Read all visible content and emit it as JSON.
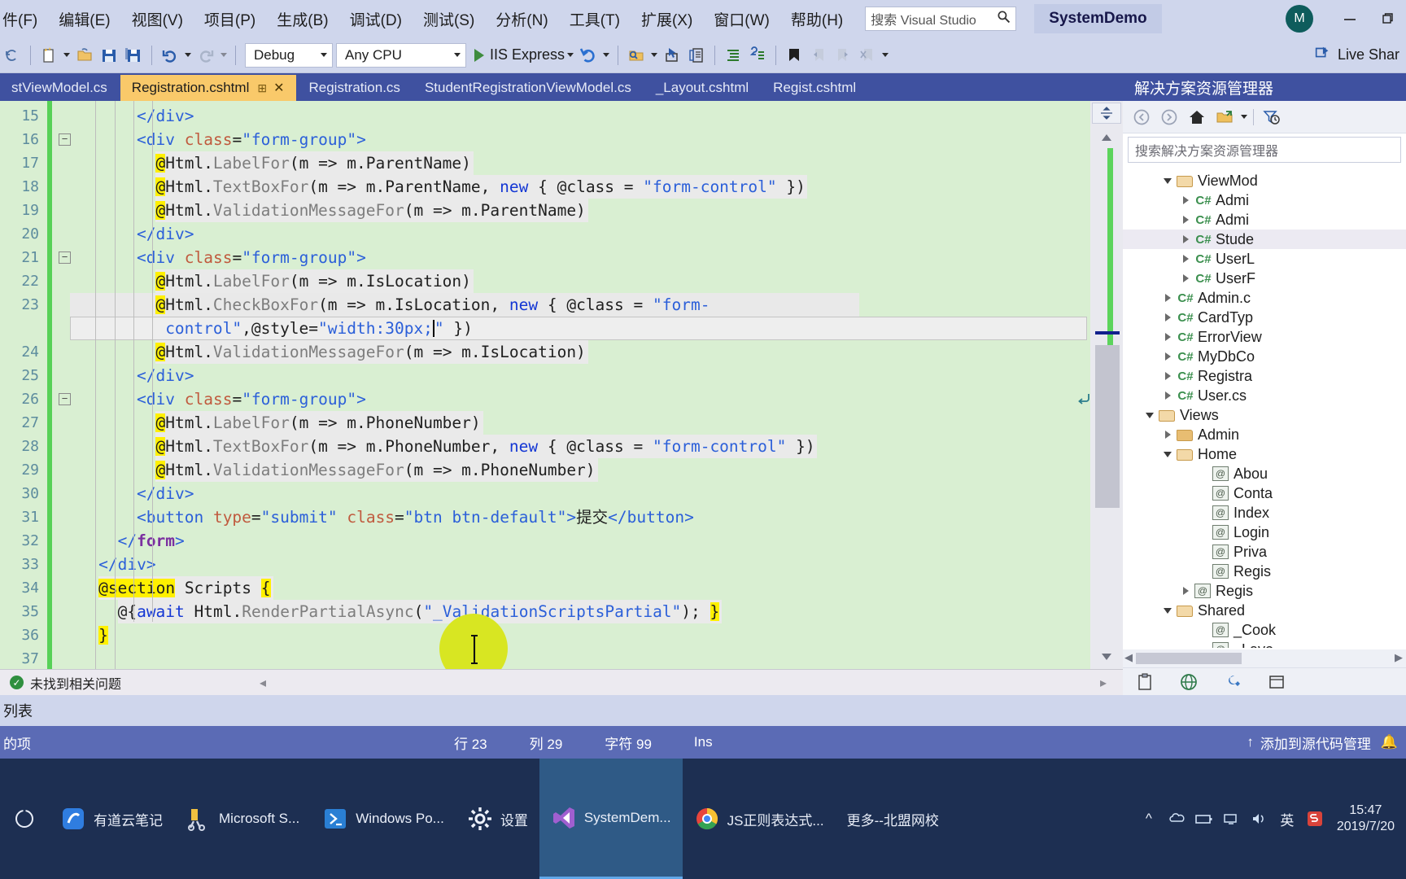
{
  "menubar": {
    "items": [
      {
        "label": "件(F)"
      },
      {
        "label": "编辑(E)"
      },
      {
        "label": "视图(V)"
      },
      {
        "label": "项目(P)"
      },
      {
        "label": "生成(B)"
      },
      {
        "label": "调试(D)"
      },
      {
        "label": "测试(S)"
      },
      {
        "label": "分析(N)"
      },
      {
        "label": "工具(T)"
      },
      {
        "label": "扩展(X)"
      },
      {
        "label": "窗口(W)"
      },
      {
        "label": "帮助(H)"
      }
    ],
    "search_placeholder": "搜索 Visual Studio",
    "solution_title": "SystemDemo",
    "avatar_initial": "M"
  },
  "toolbar": {
    "configuration": "Debug",
    "platform": "Any CPU",
    "run_label": "IIS Express",
    "live_share": "Live Shar"
  },
  "tabs": [
    {
      "label": "stViewModel.cs",
      "active": false
    },
    {
      "label": "Registration.cshtml",
      "active": true
    },
    {
      "label": "Registration.cs",
      "active": false
    },
    {
      "label": "StudentRegistrationViewModel.cs",
      "active": false
    },
    {
      "label": "_Layout.cshtml",
      "active": false
    },
    {
      "label": "Regist.cshtml",
      "active": false
    }
  ],
  "editor": {
    "file": "Registration.cshtml",
    "lines": [
      {
        "num": "15",
        "indent": 7,
        "tokens": [
          {
            "t": "</div>",
            "c": "t-tag"
          }
        ]
      },
      {
        "num": "16",
        "indent": 7,
        "fold": true,
        "tokens": [
          {
            "t": "<div ",
            "c": "t-tag"
          },
          {
            "t": "class",
            "c": "t-attr"
          },
          {
            "t": "=",
            "c": "t-plain"
          },
          {
            "t": "\"form-group\"",
            "c": "t-str"
          },
          {
            "t": ">",
            "c": "t-tag"
          }
        ]
      },
      {
        "num": "17",
        "indent": 9,
        "razor": true,
        "tokens": [
          {
            "t": "@",
            "c": "at-hl"
          },
          {
            "t": "Html.",
            "c": "t-plain"
          },
          {
            "t": "LabelFor",
            "c": "t-gray"
          },
          {
            "t": "(m => m.ParentName)",
            "c": "t-plain"
          }
        ]
      },
      {
        "num": "18",
        "indent": 9,
        "razor": true,
        "tokens": [
          {
            "t": "@",
            "c": "at-hl"
          },
          {
            "t": "Html.",
            "c": "t-plain"
          },
          {
            "t": "TextBoxFor",
            "c": "t-gray"
          },
          {
            "t": "(m => m.ParentName, ",
            "c": "t-plain"
          },
          {
            "t": "new",
            "c": "t-kw"
          },
          {
            "t": " { @class = ",
            "c": "t-plain"
          },
          {
            "t": "\"form-control\"",
            "c": "t-str"
          },
          {
            "t": " })",
            "c": "t-plain"
          }
        ]
      },
      {
        "num": "19",
        "indent": 9,
        "razor": true,
        "tokens": [
          {
            "t": "@",
            "c": "at-hl"
          },
          {
            "t": "Html.",
            "c": "t-plain"
          },
          {
            "t": "ValidationMessageFor",
            "c": "t-gray"
          },
          {
            "t": "(m => m.ParentName)",
            "c": "t-plain"
          }
        ]
      },
      {
        "num": "20",
        "indent": 7,
        "tokens": [
          {
            "t": "</div>",
            "c": "t-tag"
          }
        ]
      },
      {
        "num": "21",
        "indent": 7,
        "fold": true,
        "tokens": [
          {
            "t": "<div ",
            "c": "t-tag"
          },
          {
            "t": "class",
            "c": "t-attr"
          },
          {
            "t": "=",
            "c": "t-plain"
          },
          {
            "t": "\"form-group\"",
            "c": "t-str"
          },
          {
            "t": ">",
            "c": "t-tag"
          }
        ]
      },
      {
        "num": "22",
        "indent": 9,
        "razor": true,
        "tokens": [
          {
            "t": "@",
            "c": "at-hl"
          },
          {
            "t": "Html.",
            "c": "t-plain"
          },
          {
            "t": "LabelFor",
            "c": "t-gray"
          },
          {
            "t": "(m => m.IsLocation)",
            "c": "t-plain"
          }
        ]
      },
      {
        "num": "23",
        "indent": 9,
        "razor": true,
        "selected": true,
        "tokens": [
          {
            "t": "@",
            "c": "at-hl"
          },
          {
            "t": "Html.",
            "c": "t-plain"
          },
          {
            "t": "CheckBoxFor",
            "c": "t-gray"
          },
          {
            "t": "(m => m.IsLocation, ",
            "c": "t-plain"
          },
          {
            "t": "new",
            "c": "t-kw"
          },
          {
            "t": " { @class = ",
            "c": "t-plain"
          },
          {
            "t": "\"form-",
            "c": "t-str"
          }
        ]
      },
      {
        "num": "",
        "indent": 10,
        "wrapped": true,
        "cursorline": true,
        "tokens": [
          {
            "t": "control\"",
            "c": "t-str"
          },
          {
            "t": ",@style=",
            "c": "t-plain"
          },
          {
            "t": "\"width:30px;",
            "c": "t-str"
          },
          {
            "t": "CARET",
            "c": "caret"
          },
          {
            "t": "\"",
            "c": "t-str"
          },
          {
            "t": " })",
            "c": "t-plain"
          }
        ]
      },
      {
        "num": "24",
        "indent": 9,
        "razor": true,
        "tokens": [
          {
            "t": "@",
            "c": "at-hl"
          },
          {
            "t": "Html.",
            "c": "t-plain"
          },
          {
            "t": "ValidationMessageFor",
            "c": "t-gray"
          },
          {
            "t": "(m => m.IsLocation)",
            "c": "t-plain"
          }
        ]
      },
      {
        "num": "25",
        "indent": 7,
        "tokens": [
          {
            "t": "</div>",
            "c": "t-tag"
          }
        ]
      },
      {
        "num": "26",
        "indent": 7,
        "fold": true,
        "tokens": [
          {
            "t": "<div ",
            "c": "t-tag"
          },
          {
            "t": "class",
            "c": "t-attr"
          },
          {
            "t": "=",
            "c": "t-plain"
          },
          {
            "t": "\"form-group\"",
            "c": "t-str"
          },
          {
            "t": ">",
            "c": "t-tag"
          }
        ]
      },
      {
        "num": "27",
        "indent": 9,
        "razor": true,
        "tokens": [
          {
            "t": "@",
            "c": "at-hl"
          },
          {
            "t": "Html.",
            "c": "t-plain"
          },
          {
            "t": "LabelFor",
            "c": "t-gray"
          },
          {
            "t": "(m => m.PhoneNumber)",
            "c": "t-plain"
          }
        ]
      },
      {
        "num": "28",
        "indent": 9,
        "razor": true,
        "tokens": [
          {
            "t": "@",
            "c": "at-hl"
          },
          {
            "t": "Html.",
            "c": "t-plain"
          },
          {
            "t": "TextBoxFor",
            "c": "t-gray"
          },
          {
            "t": "(m => m.PhoneNumber, ",
            "c": "t-plain"
          },
          {
            "t": "new",
            "c": "t-kw"
          },
          {
            "t": " { @class = ",
            "c": "t-plain"
          },
          {
            "t": "\"form-control\"",
            "c": "t-str"
          },
          {
            "t": " })",
            "c": "t-plain"
          }
        ]
      },
      {
        "num": "29",
        "indent": 9,
        "razor": true,
        "tokens": [
          {
            "t": "@",
            "c": "at-hl"
          },
          {
            "t": "Html.",
            "c": "t-plain"
          },
          {
            "t": "ValidationMessageFor",
            "c": "t-gray"
          },
          {
            "t": "(m => m.PhoneNumber)",
            "c": "t-plain"
          }
        ]
      },
      {
        "num": "30",
        "indent": 7,
        "tokens": [
          {
            "t": "</div>",
            "c": "t-tag"
          }
        ]
      },
      {
        "num": "31",
        "indent": 7,
        "tokens": [
          {
            "t": "<button ",
            "c": "t-tag"
          },
          {
            "t": "type",
            "c": "t-attr"
          },
          {
            "t": "=",
            "c": "t-plain"
          },
          {
            "t": "\"submit\"",
            "c": "t-str"
          },
          {
            "t": " ",
            "c": "t-plain"
          },
          {
            "t": "class",
            "c": "t-attr"
          },
          {
            "t": "=",
            "c": "t-plain"
          },
          {
            "t": "\"btn btn-default\"",
            "c": "t-str"
          },
          {
            "t": ">",
            "c": "t-tag"
          },
          {
            "t": "提交",
            "c": "t-plain"
          },
          {
            "t": "</button>",
            "c": "t-tag"
          }
        ]
      },
      {
        "num": "32",
        "indent": 5,
        "tokens": [
          {
            "t": "</",
            "c": "t-tag"
          },
          {
            "t": "form",
            "c": "t-purple"
          },
          {
            "t": ">",
            "c": "t-tag"
          }
        ]
      },
      {
        "num": "33",
        "indent": 3,
        "tokens": [
          {
            "t": "</div>",
            "c": "t-tag"
          }
        ]
      },
      {
        "num": "34",
        "indent": 3,
        "razor": true,
        "tokens": [
          {
            "t": "@section",
            "c": "at-hl"
          },
          {
            "t": " Scripts ",
            "c": "t-plain"
          },
          {
            "t": "{",
            "c": "at-hl"
          }
        ]
      },
      {
        "num": "35",
        "indent": 5,
        "razor": true,
        "tokens": [
          {
            "t": "@{",
            "c": "t-plain"
          },
          {
            "t": "await",
            "c": "t-kw"
          },
          {
            "t": " Html.",
            "c": "t-plain"
          },
          {
            "t": "RenderPartialAsync",
            "c": "t-gray"
          },
          {
            "t": "(",
            "c": "t-plain"
          },
          {
            "t": "\"_ValidationScriptsPartial\"",
            "c": "t-str"
          },
          {
            "t": "); ",
            "c": "t-plain"
          },
          {
            "t": "}",
            "c": "at-hl"
          }
        ]
      },
      {
        "num": "36",
        "indent": 3,
        "tokens": [
          {
            "t": "}",
            "c": "at-hl"
          }
        ]
      },
      {
        "num": "37",
        "indent": 3,
        "tokens": []
      }
    ]
  },
  "infobar": {
    "message": "未找到相关问题",
    "ok_glyph": "✓"
  },
  "solution_explorer": {
    "title": "解决方案资源管理器",
    "search_placeholder": "搜索解决方案资源管理器",
    "tree": [
      {
        "label": "ViewMod",
        "depth": 2,
        "kind": "folder-open",
        "expander": "down",
        "selected": false
      },
      {
        "label": "Admi",
        "depth": 3,
        "kind": "cs",
        "expander": "right",
        "selected": false
      },
      {
        "label": "Admi",
        "depth": 3,
        "kind": "cs",
        "expander": "right",
        "selected": false
      },
      {
        "label": "Stude",
        "depth": 3,
        "kind": "cs",
        "expander": "right",
        "selected": true
      },
      {
        "label": "UserL",
        "depth": 3,
        "kind": "cs",
        "expander": "right",
        "selected": false
      },
      {
        "label": "UserF",
        "depth": 3,
        "kind": "cs",
        "expander": "right",
        "selected": false
      },
      {
        "label": "Admin.c",
        "depth": 2,
        "kind": "cs",
        "expander": "right",
        "selected": false
      },
      {
        "label": "CardTyp",
        "depth": 2,
        "kind": "cs",
        "expander": "right",
        "selected": false
      },
      {
        "label": "ErrorView",
        "depth": 2,
        "kind": "cs",
        "expander": "right",
        "selected": false
      },
      {
        "label": "MyDbCo",
        "depth": 2,
        "kind": "cs",
        "expander": "right",
        "selected": false
      },
      {
        "label": "Registra",
        "depth": 2,
        "kind": "cs",
        "expander": "right",
        "selected": false
      },
      {
        "label": "User.cs",
        "depth": 2,
        "kind": "cs",
        "expander": "right",
        "selected": false
      },
      {
        "label": "Views",
        "depth": 1,
        "kind": "folder-open",
        "expander": "down",
        "selected": false
      },
      {
        "label": "Admin",
        "depth": 2,
        "kind": "folder",
        "expander": "right",
        "selected": false
      },
      {
        "label": "Home",
        "depth": 2,
        "kind": "folder-open",
        "expander": "down",
        "selected": false
      },
      {
        "label": "Abou",
        "depth": 4,
        "kind": "razor",
        "expander": "none",
        "selected": false
      },
      {
        "label": "Conta",
        "depth": 4,
        "kind": "razor",
        "expander": "none",
        "selected": false
      },
      {
        "label": "Index",
        "depth": 4,
        "kind": "razor",
        "expander": "none",
        "selected": false
      },
      {
        "label": "Login",
        "depth": 4,
        "kind": "razor",
        "expander": "none",
        "selected": false
      },
      {
        "label": "Priva",
        "depth": 4,
        "kind": "razor",
        "expander": "none",
        "selected": false
      },
      {
        "label": "Regis",
        "depth": 4,
        "kind": "razor",
        "expander": "none",
        "selected": false
      },
      {
        "label": "Regis",
        "depth": 3,
        "kind": "razor",
        "expander": "right",
        "selected": false
      },
      {
        "label": "Shared",
        "depth": 2,
        "kind": "folder-open",
        "expander": "down",
        "selected": false
      },
      {
        "label": "_Cook",
        "depth": 4,
        "kind": "razor",
        "expander": "none",
        "selected": false
      },
      {
        "label": "_Layo",
        "depth": 4,
        "kind": "razor",
        "expander": "none",
        "selected": false
      }
    ]
  },
  "strips": {
    "list_label": "列表"
  },
  "statusbar": {
    "left": "的项",
    "line_label": "行 23",
    "column_label": "列 29",
    "char_label": "字符 99",
    "insert_mode": "Ins",
    "source_control": "添加到源代码管理"
  },
  "taskbar": {
    "items": [
      {
        "label": "有道云笔记",
        "icon": "youdao-icon",
        "active": false
      },
      {
        "label": "Microsoft S...",
        "icon": "snip-icon",
        "active": false
      },
      {
        "label": "Windows Po...",
        "icon": "powershell-icon",
        "active": false
      },
      {
        "label": "设置",
        "icon": "settings-icon",
        "active": false
      },
      {
        "label": "SystemDem...",
        "icon": "visualstudio-icon",
        "active": true
      },
      {
        "label": "JS正则表达式...",
        "icon": "chrome-icon",
        "active": false
      },
      {
        "label": "更多--北盟网校",
        "icon": "none",
        "active": false
      }
    ],
    "tray": {
      "lang": "英",
      "time": "15:47",
      "date": "2019/7/20"
    }
  },
  "colors": {
    "chrome": "#cfd6ec",
    "tab_active": "#f9c96a",
    "tab_bar": "#3f51a0",
    "editor_bg": "#d9efd2",
    "statusbar": "#5b6bb5",
    "taskbar": "#1d2f52",
    "accent_green": "#57d157"
  }
}
